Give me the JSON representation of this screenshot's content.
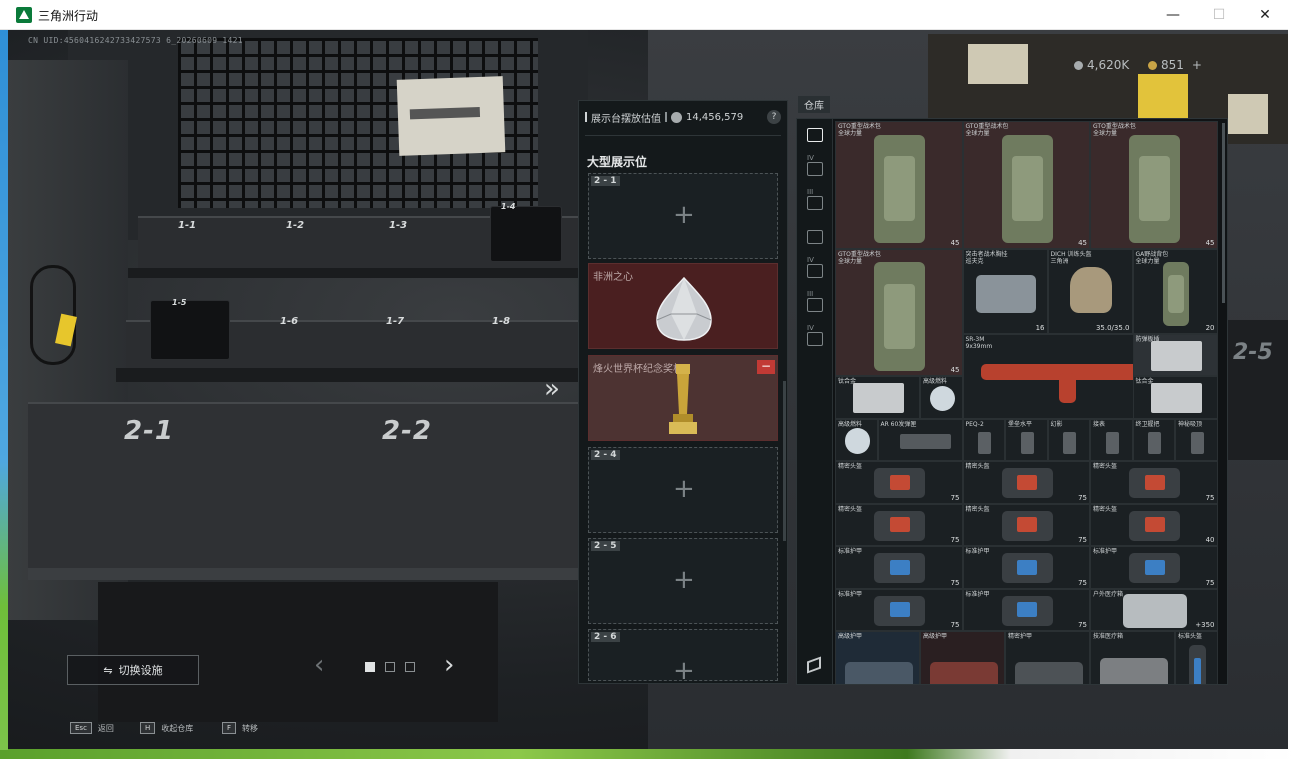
{
  "window": {
    "title": "三角洲行动",
    "minimize": "—",
    "maximize": "☐",
    "close": "✕"
  },
  "uid": "CN UID:4560416242733427573 6_20260609 1421",
  "currency": {
    "money": "4,620K",
    "coupon": "851",
    "plus": "+"
  },
  "shelf_labels": [
    "1-1",
    "1-2",
    "1-3",
    "1-4",
    "1-5",
    "1-6",
    "1-7",
    "1-8",
    "2-1",
    "2-2"
  ],
  "right_bg_label": "2-5",
  "controls": {
    "switch_label": "切换设施",
    "switch_icon": "⇋",
    "next_arrows": "»",
    "prev": "‹",
    "next": "›"
  },
  "hints": [
    {
      "key": "Esc",
      "label": "返回"
    },
    {
      "key": "H",
      "label": "收起仓库"
    },
    {
      "key": "F",
      "label": "转移"
    }
  ],
  "display_panel": {
    "estimate_label": "展示台摆放估值",
    "estimate_value": "14,456,579",
    "help": "?",
    "section_title": "大型展示位",
    "slots": [
      {
        "id": "2 - 1",
        "plus": "+"
      },
      {
        "name": "非洲之心"
      },
      {
        "name": "烽火世界杯纪念奖杯",
        "remove": "−"
      },
      {
        "id": "2 - 4",
        "plus": "+"
      },
      {
        "id": "2 - 5",
        "plus": "+"
      },
      {
        "id": "2 - 6",
        "plus": "+"
      }
    ]
  },
  "stash": {
    "tag": "仓库",
    "tabs": [
      "IV",
      "III",
      "",
      "IV",
      "III",
      "IV"
    ],
    "items": [
      {
        "name": "GTO重型战术包\n全球力量",
        "value": "45"
      },
      {
        "name": "GTO重型战术包\n全球力量",
        "value": "45"
      },
      {
        "name": "GTO重型战术包\n全球力量",
        "value": "45"
      },
      {
        "name": "GTO重型战术包\n全球力量",
        "value": "45"
      },
      {
        "name": "突击者战术胸挂\n巡夫克",
        "value": "16"
      },
      {
        "name": "DICH 训练头盔\n三角洲",
        "value": "35.0/35.0"
      },
      {
        "name": "GA野战背包\n全球力量",
        "value": "20"
      },
      {
        "name": "SR-3M\n9x39mm",
        "value": "30/30"
      },
      {
        "name": "防弹板插",
        "value": ""
      },
      {
        "name": "钛合金",
        "value": ""
      },
      {
        "name": "高级燃料",
        "value": ""
      },
      {
        "name": "钛合金",
        "value": ""
      },
      {
        "name": "高级燃料",
        "value": ""
      },
      {
        "name": "AR 60发弹匣",
        "value": ""
      },
      {
        "name": "PEQ-2",
        "value": ""
      },
      {
        "name": "堡垒水平",
        "value": ""
      },
      {
        "name": "幻影",
        "value": ""
      },
      {
        "name": "接表",
        "value": ""
      },
      {
        "name": "终卫握把",
        "value": ""
      },
      {
        "name": "神秘吸顶",
        "value": ""
      },
      {
        "name": "精密头盔",
        "value": "75"
      },
      {
        "name": "精密头盔",
        "value": "75"
      },
      {
        "name": "精密头盔",
        "value": "75"
      },
      {
        "name": "精密头盔",
        "value": "75"
      },
      {
        "name": "精密头盔",
        "value": "75"
      },
      {
        "name": "精密头盔",
        "value": "40"
      },
      {
        "name": "标准护甲",
        "value": "75"
      },
      {
        "name": "标准护甲",
        "value": "75"
      },
      {
        "name": "标准护甲",
        "value": "75"
      },
      {
        "name": "标准护甲",
        "value": "75"
      },
      {
        "name": "标准护甲",
        "value": "75"
      },
      {
        "name": "户外医疗箱",
        "value": "+350"
      },
      {
        "name": "高级护甲",
        "value": ""
      },
      {
        "name": "高级护甲",
        "value": ""
      },
      {
        "name": "精密护甲",
        "value": ""
      },
      {
        "name": "技准医疗箱",
        "value": ""
      },
      {
        "name": "标准头盔",
        "value": ""
      }
    ]
  },
  "colors": {
    "accent_red": "#c23a35",
    "filled_slot": "#4a1f20",
    "panel_bg": "#14191b"
  }
}
